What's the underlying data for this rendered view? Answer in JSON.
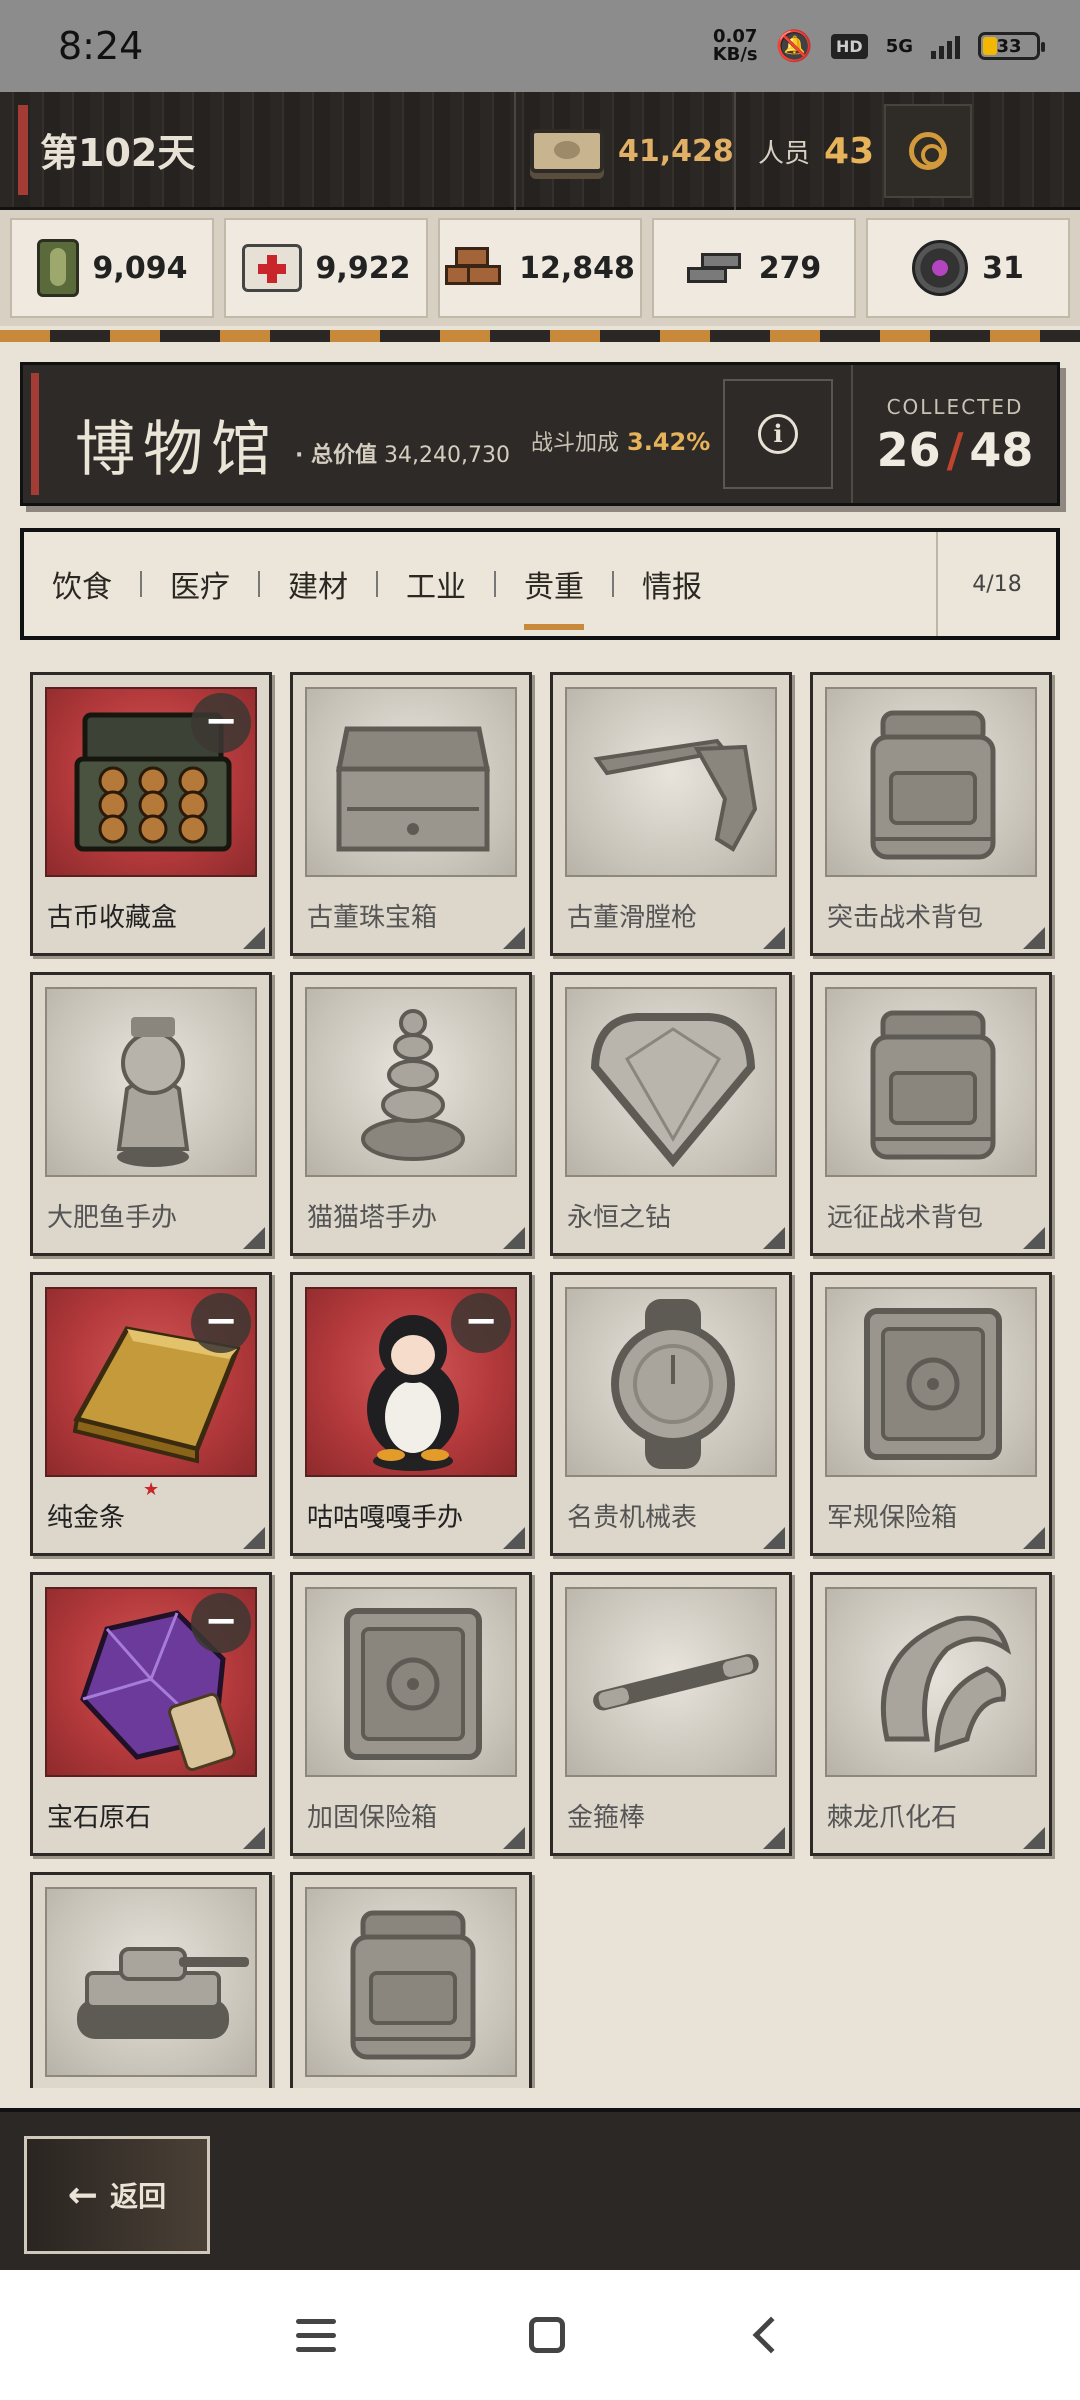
{
  "status_bar": {
    "time": "8:24",
    "net_speed_value": "0.07",
    "net_speed_unit": "KB/s",
    "hd": "HD",
    "network": "5G",
    "battery": "33"
  },
  "header": {
    "day_label": "第102天",
    "cash": "41,428",
    "staff_label": "人员",
    "staff_count": "43"
  },
  "resources": [
    {
      "icon": "food-can-icon",
      "value": "9,094"
    },
    {
      "icon": "medkit-icon",
      "value": "9,922"
    },
    {
      "icon": "bricks-icon",
      "value": "12,848"
    },
    {
      "icon": "metal-bars-icon",
      "value": "279"
    },
    {
      "icon": "chip-gear-icon",
      "value": "31"
    }
  ],
  "museum": {
    "title": "博物馆",
    "total_value_label": "· 总价值",
    "total_value": "34,240,730",
    "combat_bonus_label": "战斗加成",
    "combat_bonus": "3.42%",
    "collected_label": "COLLECTED",
    "collected_count": "26",
    "collected_total": "48"
  },
  "tabs": {
    "items": [
      "饮食",
      "医疗",
      "建材",
      "工业",
      "贵重",
      "情报"
    ],
    "active_index": 4,
    "page": "4/18"
  },
  "items": [
    {
      "name": "古币收藏盒",
      "owned": true,
      "icon": "coin-box-icon"
    },
    {
      "name": "古董珠宝箱",
      "owned": false,
      "icon": "jewelry-chest-icon"
    },
    {
      "name": "古董滑膛枪",
      "owned": false,
      "icon": "musket-icon"
    },
    {
      "name": "突击战术背包",
      "owned": false,
      "icon": "backpack-icon"
    },
    {
      "name": "大肥鱼手办",
      "owned": false,
      "icon": "figurine-icon"
    },
    {
      "name": "猫猫塔手办",
      "owned": false,
      "icon": "cat-tower-icon"
    },
    {
      "name": "永恒之钻",
      "owned": false,
      "icon": "diamond-icon"
    },
    {
      "name": "远征战术背包",
      "owned": false,
      "icon": "backpack-icon"
    },
    {
      "name": "纯金条",
      "owned": true,
      "icon": "gold-bar-icon",
      "star": "★"
    },
    {
      "name": "咕咕嘎嘎手办",
      "owned": true,
      "icon": "penguin-figurine-icon"
    },
    {
      "name": "名贵机械表",
      "owned": false,
      "icon": "watch-icon"
    },
    {
      "name": "军规保险箱",
      "owned": false,
      "icon": "safe-icon"
    },
    {
      "name": "宝石原石",
      "owned": true,
      "icon": "gemstone-icon"
    },
    {
      "name": "加固保险箱",
      "owned": false,
      "icon": "safe-icon"
    },
    {
      "name": "金箍棒",
      "owned": false,
      "icon": "staff-icon"
    },
    {
      "name": "棘龙爪化石",
      "owned": false,
      "icon": "claw-fossil-icon"
    },
    {
      "name": "",
      "owned": false,
      "icon": "tank-icon"
    },
    {
      "name": "",
      "owned": false,
      "icon": "backpack-icon"
    }
  ],
  "remove_symbol": "−",
  "bottom": {
    "back_arrow": "←",
    "back_label": "返回"
  },
  "info_symbol": "i"
}
